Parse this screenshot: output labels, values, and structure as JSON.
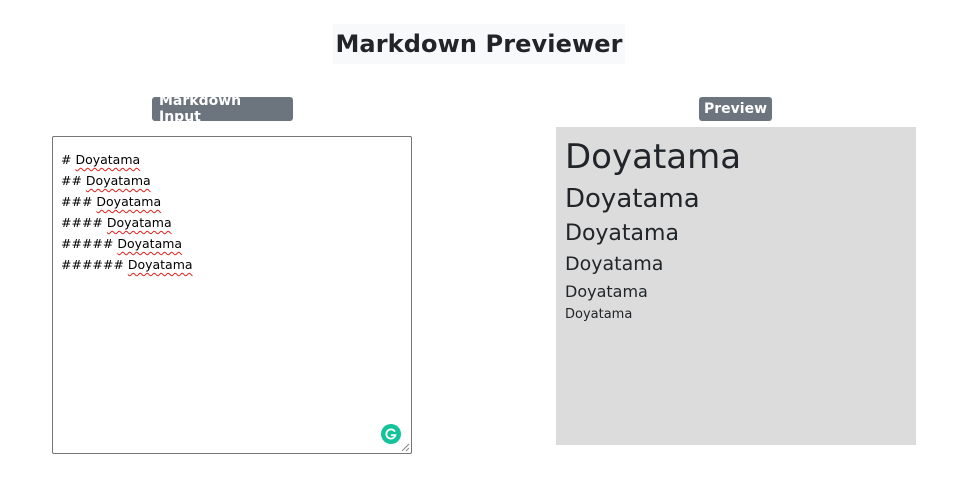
{
  "header": {
    "title": "Markdown Previewer"
  },
  "input_panel": {
    "badge": "Markdown Input",
    "lines": [
      {
        "prefix": "# ",
        "word": "Doyatama"
      },
      {
        "prefix": "## ",
        "word": "Doyatama"
      },
      {
        "prefix": "### ",
        "word": "Doyatama"
      },
      {
        "prefix": "#### ",
        "word": "Doyatama"
      },
      {
        "prefix": "##### ",
        "word": "Doyatama"
      },
      {
        "prefix": "###### ",
        "word": "Doyatama"
      }
    ],
    "assistant_icon": "grammarly-icon",
    "spellcheck_color": "#e0201d",
    "assistant_color": "#15c39a"
  },
  "preview_panel": {
    "badge": "Preview",
    "headings": {
      "h1": "Doyatama",
      "h2": "Doyatama",
      "h3": "Doyatama",
      "h4": "Doyatama",
      "h5": "Doyatama",
      "h6": "Doyatama"
    },
    "background": "#dcdcdc"
  },
  "colors": {
    "badge_bg": "#6c757d",
    "title_bg": "#f8f9fa"
  }
}
